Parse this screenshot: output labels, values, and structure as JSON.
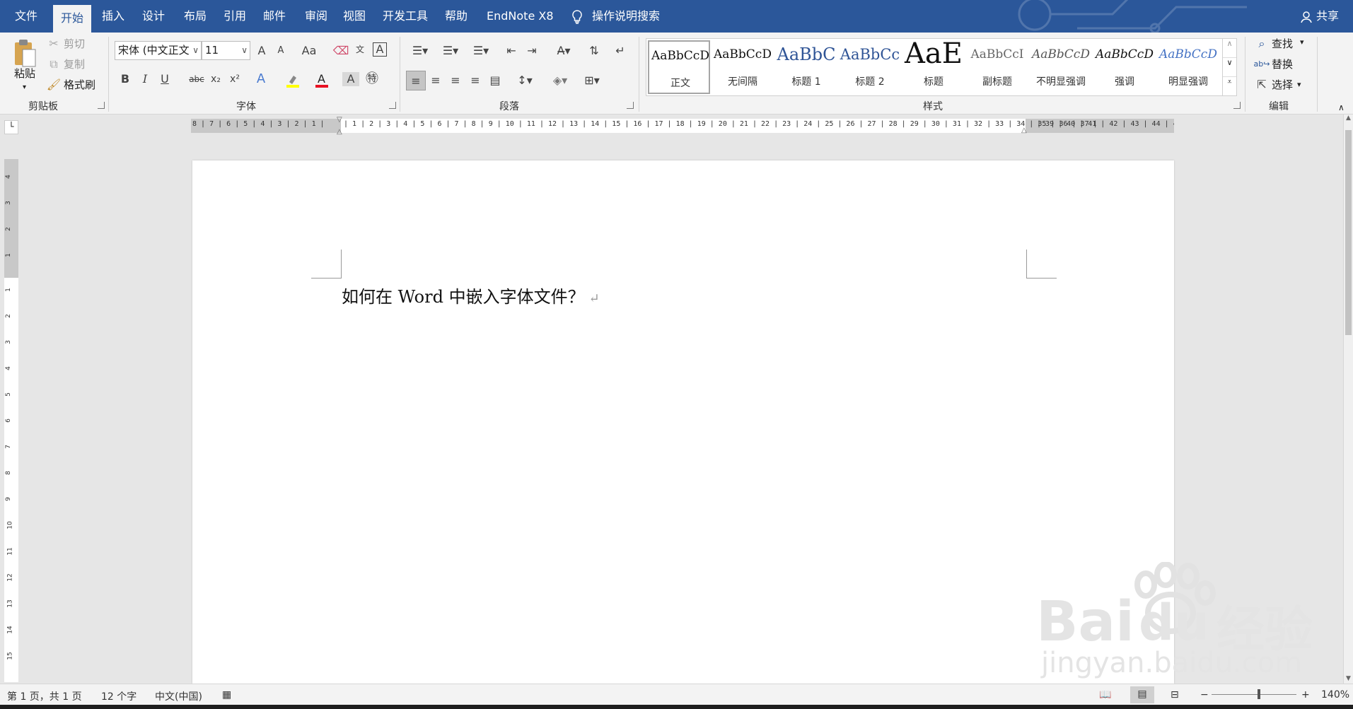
{
  "menu": {
    "items": [
      "文件",
      "开始",
      "插入",
      "设计",
      "布局",
      "引用",
      "邮件",
      "审阅",
      "视图",
      "开发工具",
      "帮助",
      "EndNote X8"
    ],
    "active": "开始",
    "tell_me": "操作说明搜索",
    "share": "共享"
  },
  "clipboard": {
    "paste": "粘贴",
    "cut": "剪切",
    "copy": "复制",
    "format_painter": "格式刷",
    "group": "剪贴板"
  },
  "font": {
    "name": "宋体 (中文正文",
    "size": "11",
    "grow": "A",
    "shrink": "A",
    "case": "Aa",
    "group": "字体"
  },
  "paragraph": {
    "group": "段落"
  },
  "styles": {
    "group": "样式",
    "items": [
      {
        "preview": "AaBbCcD",
        "name": "正文"
      },
      {
        "preview": "AaBbCcD",
        "name": "无间隔"
      },
      {
        "preview": "AaBbC",
        "name": "标题 1"
      },
      {
        "preview": "AaBbCc",
        "name": "标题 2"
      },
      {
        "preview": "AaE",
        "name": "标题"
      },
      {
        "preview": "AaBbCcI",
        "name": "副标题"
      },
      {
        "preview": "AaBbCcD",
        "name": "不明显强调"
      },
      {
        "preview": "AaBbCcD",
        "name": "强调"
      },
      {
        "preview": "AaBbCcD",
        "name": "明显强调"
      }
    ]
  },
  "editing": {
    "find": "查找",
    "replace": "替换",
    "select": "选择",
    "group": "编辑"
  },
  "document": {
    "text": "如何在 Word 中嵌入字体文件？",
    "para_mark": "↵"
  },
  "ruler": {
    "left": "8 | 7 | 6 | 5 | 4 | 3 | 2 | 1 |",
    "main": "| 1 | 2 | 3 | 4 | 5 | 6 | 7 | 8 | 9 | 10 | 11 | 12 | 13 | 14 | 15 | 16 | 17 | 18 | 19 | 20 | 21 | 22 | 23 | 24 | 25 | 26 | 27 | 28 | 29 | 30 | 31 | 32 | 33 | 34 | 35 | 36 | 37 |",
    "right": "| 39 | 40 | 41 | 42 | 43 | 44 | 45 |",
    "vertical": [
      "4",
      "3",
      "2",
      "1",
      "1",
      "2",
      "3",
      "4",
      "5",
      "6",
      "7",
      "8",
      "9",
      "10",
      "11",
      "12",
      "13",
      "14",
      "15"
    ]
  },
  "status": {
    "page": "第 1 页，共 1 页",
    "words": "12 个字",
    "lang": "中文(中国)",
    "zoom": "140%"
  },
  "watermark": {
    "brand": "Bai",
    "brand2": "du",
    "cn": "经验",
    "url": "jingyan.baidu.com"
  },
  "colors": {
    "accent": "#2b579a",
    "ribbon": "#f3f3f3",
    "font_color": "#e81123",
    "highlight": "#ffff00"
  }
}
